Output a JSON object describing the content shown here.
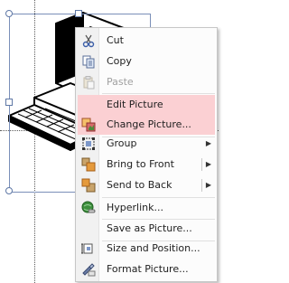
{
  "menu": {
    "items": [
      {
        "key": "cut",
        "label": "Cut",
        "icon": "scissors-icon",
        "enabled": true
      },
      {
        "key": "copy",
        "label": "Copy",
        "icon": "copy-icon",
        "enabled": true
      },
      {
        "key": "paste",
        "label": "Paste",
        "icon": "paste-icon",
        "enabled": false
      },
      {
        "key": "edit_picture",
        "label": "Edit Picture",
        "icon": "",
        "enabled": true,
        "highlighted": true
      },
      {
        "key": "change_picture",
        "label": "Change Picture...",
        "icon": "change-picture-icon",
        "enabled": true,
        "highlighted": true
      },
      {
        "key": "group",
        "label": "Group",
        "icon": "group-icon",
        "enabled": true,
        "submenu": true
      },
      {
        "key": "bring_to_front",
        "label": "Bring to Front",
        "icon": "bring-to-front-icon",
        "enabled": true,
        "submenu": true
      },
      {
        "key": "send_to_back",
        "label": "Send to Back",
        "icon": "send-to-back-icon",
        "enabled": true,
        "submenu": true
      },
      {
        "key": "hyperlink",
        "label": "Hyperlink...",
        "icon": "hyperlink-icon",
        "enabled": true
      },
      {
        "key": "save_as_picture",
        "label": "Save as Picture...",
        "icon": "",
        "enabled": true
      },
      {
        "key": "size_and_position",
        "label": "Size and Position...",
        "icon": "size-position-icon",
        "enabled": true
      },
      {
        "key": "format_picture",
        "label": "Format Picture...",
        "icon": "format-picture-icon",
        "enabled": true
      }
    ],
    "highlight_color": "#fbd0d3"
  },
  "canvas": {
    "selected_object": "computer-clipart",
    "selection_border_color": "#7a8fb8"
  }
}
